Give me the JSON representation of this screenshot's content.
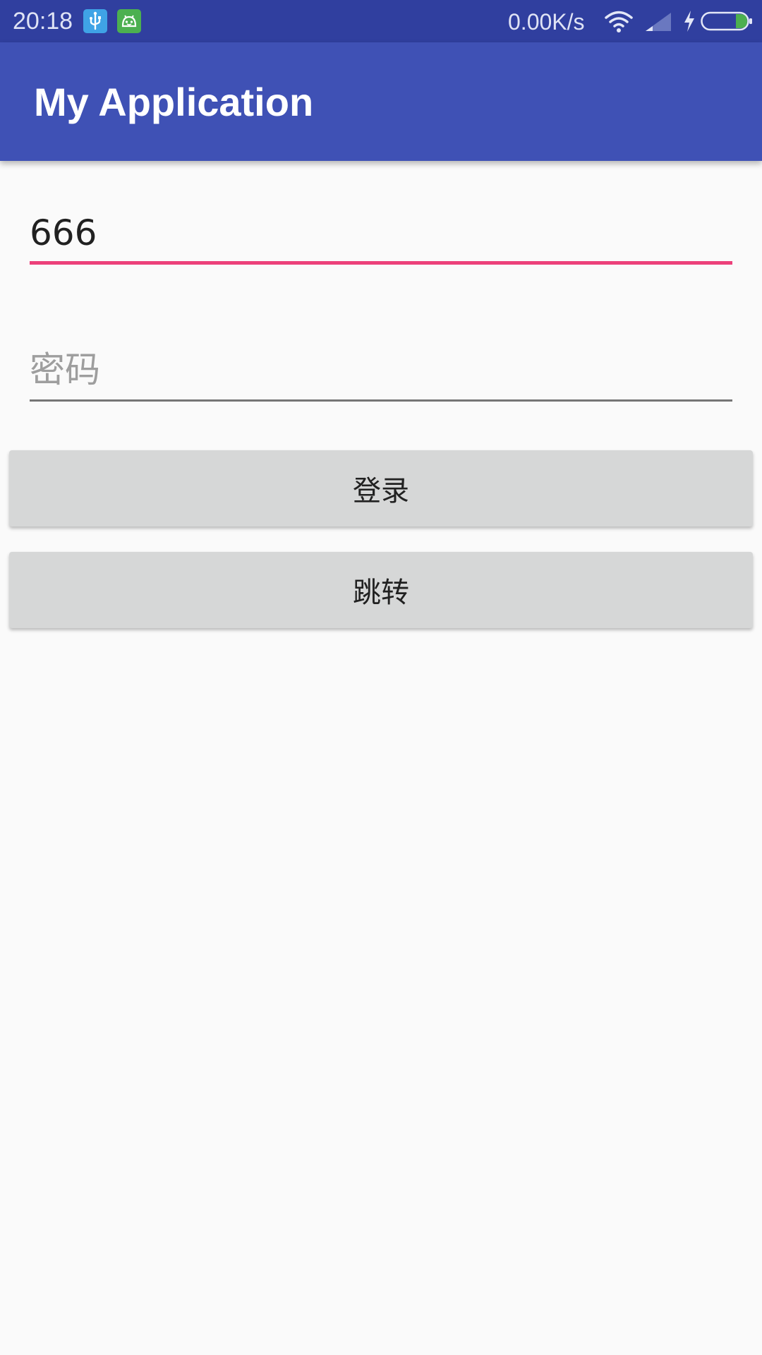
{
  "status_bar": {
    "time": "20:18",
    "notifications": [
      "usb-icon",
      "android-icon"
    ],
    "network_speed": "0.00K/s",
    "icons": [
      "wifi-icon",
      "signal-icon",
      "charging-icon",
      "battery-icon"
    ],
    "background_color": "#303f9f"
  },
  "app_bar": {
    "title": "My Application",
    "background_color": "#3f51b5"
  },
  "form": {
    "username": {
      "value": "666",
      "underline_color": "#ec407a"
    },
    "password": {
      "value": "",
      "placeholder": "密码",
      "underline_color": "#757575"
    }
  },
  "buttons": {
    "login_label": "登录",
    "jump_label": "跳转",
    "background_color": "#d6d7d7"
  }
}
